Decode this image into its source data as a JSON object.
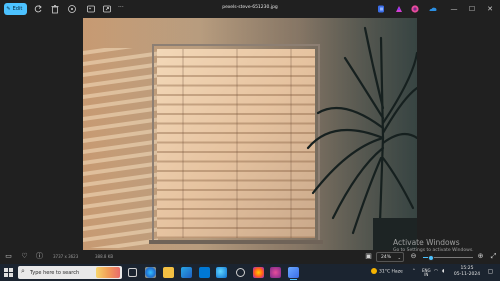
{
  "toolbar": {
    "edit_label": "Edit",
    "filename": "pexels-steve-651230.jpg",
    "more_label": "···"
  },
  "window": {
    "min": "—",
    "max": "☐",
    "close": "✕"
  },
  "infobar": {
    "dimensions": "3737 x 3623",
    "file_size": "388.8 KB",
    "zoom": "24%",
    "zoom_fraction": 0.15
  },
  "watermark": {
    "title": "Activate Windows",
    "subtitle": "Go to Settings to activate Windows."
  },
  "taskbar": {
    "search_placeholder": "Type here to search",
    "weather": "31°C  Haze",
    "lang": "ENG",
    "region": "IN",
    "time": "15:25",
    "date": "05-11-2024"
  },
  "colors": {
    "accent": "#4cc2ff",
    "taskbar": "#1b2430",
    "chrome": "#202020"
  }
}
